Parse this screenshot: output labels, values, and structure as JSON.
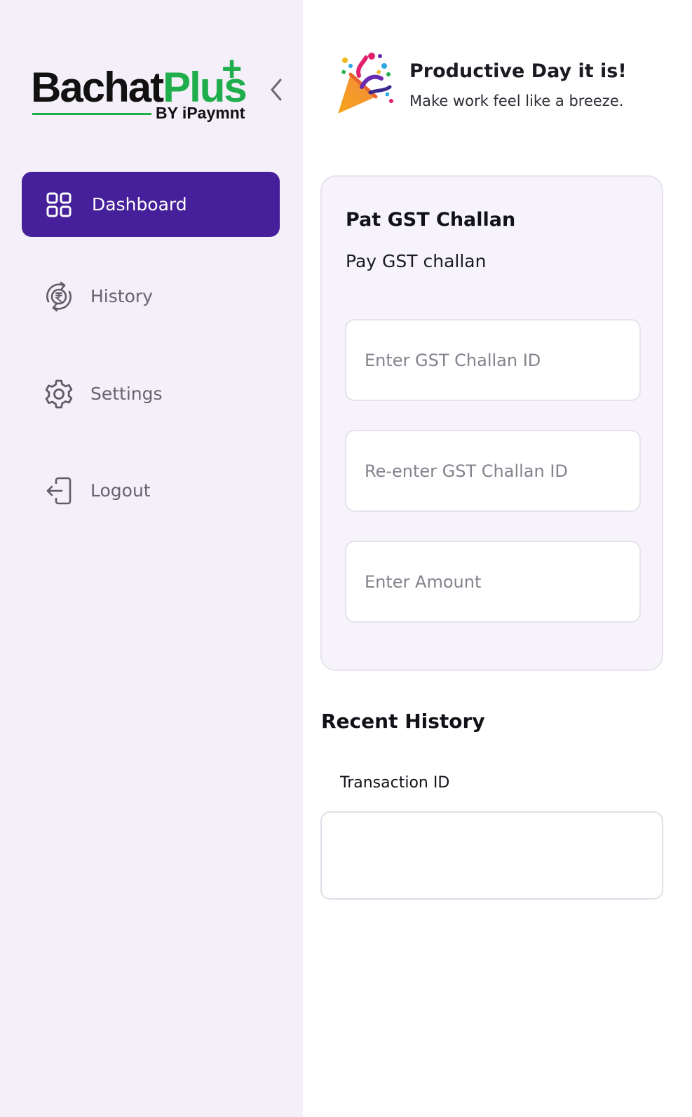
{
  "brand": {
    "name_part1": "Bachat",
    "name_part2": "Plus",
    "plus_symbol": "+",
    "byline": "BY iPaymnt",
    "accent_green": "#1fae4b",
    "accent_purple": "#46209a"
  },
  "sidebar": {
    "collapse_icon": "chevron-left-icon",
    "items": [
      {
        "label": "Dashboard",
        "icon": "grid-icon",
        "active": true
      },
      {
        "label": "History",
        "icon": "rupee-history-icon",
        "active": false
      },
      {
        "label": "Settings",
        "icon": "gear-icon",
        "active": false
      },
      {
        "label": "Logout",
        "icon": "logout-icon",
        "active": false
      }
    ]
  },
  "greeting": {
    "icon": "party-popper-icon",
    "title": "Productive Day it is!",
    "subtitle": "Make work feel like a breeze."
  },
  "challan_form": {
    "title": "Pat GST Challan",
    "subtitle": "Pay GST challan",
    "challan_id_placeholder": "Enter GST Challan ID",
    "reenter_challan_id_placeholder": "Re-enter GST Challan ID",
    "amount_placeholder": "Enter Amount"
  },
  "recent_history": {
    "title": "Recent History",
    "column_transaction_id": "Transaction ID"
  }
}
